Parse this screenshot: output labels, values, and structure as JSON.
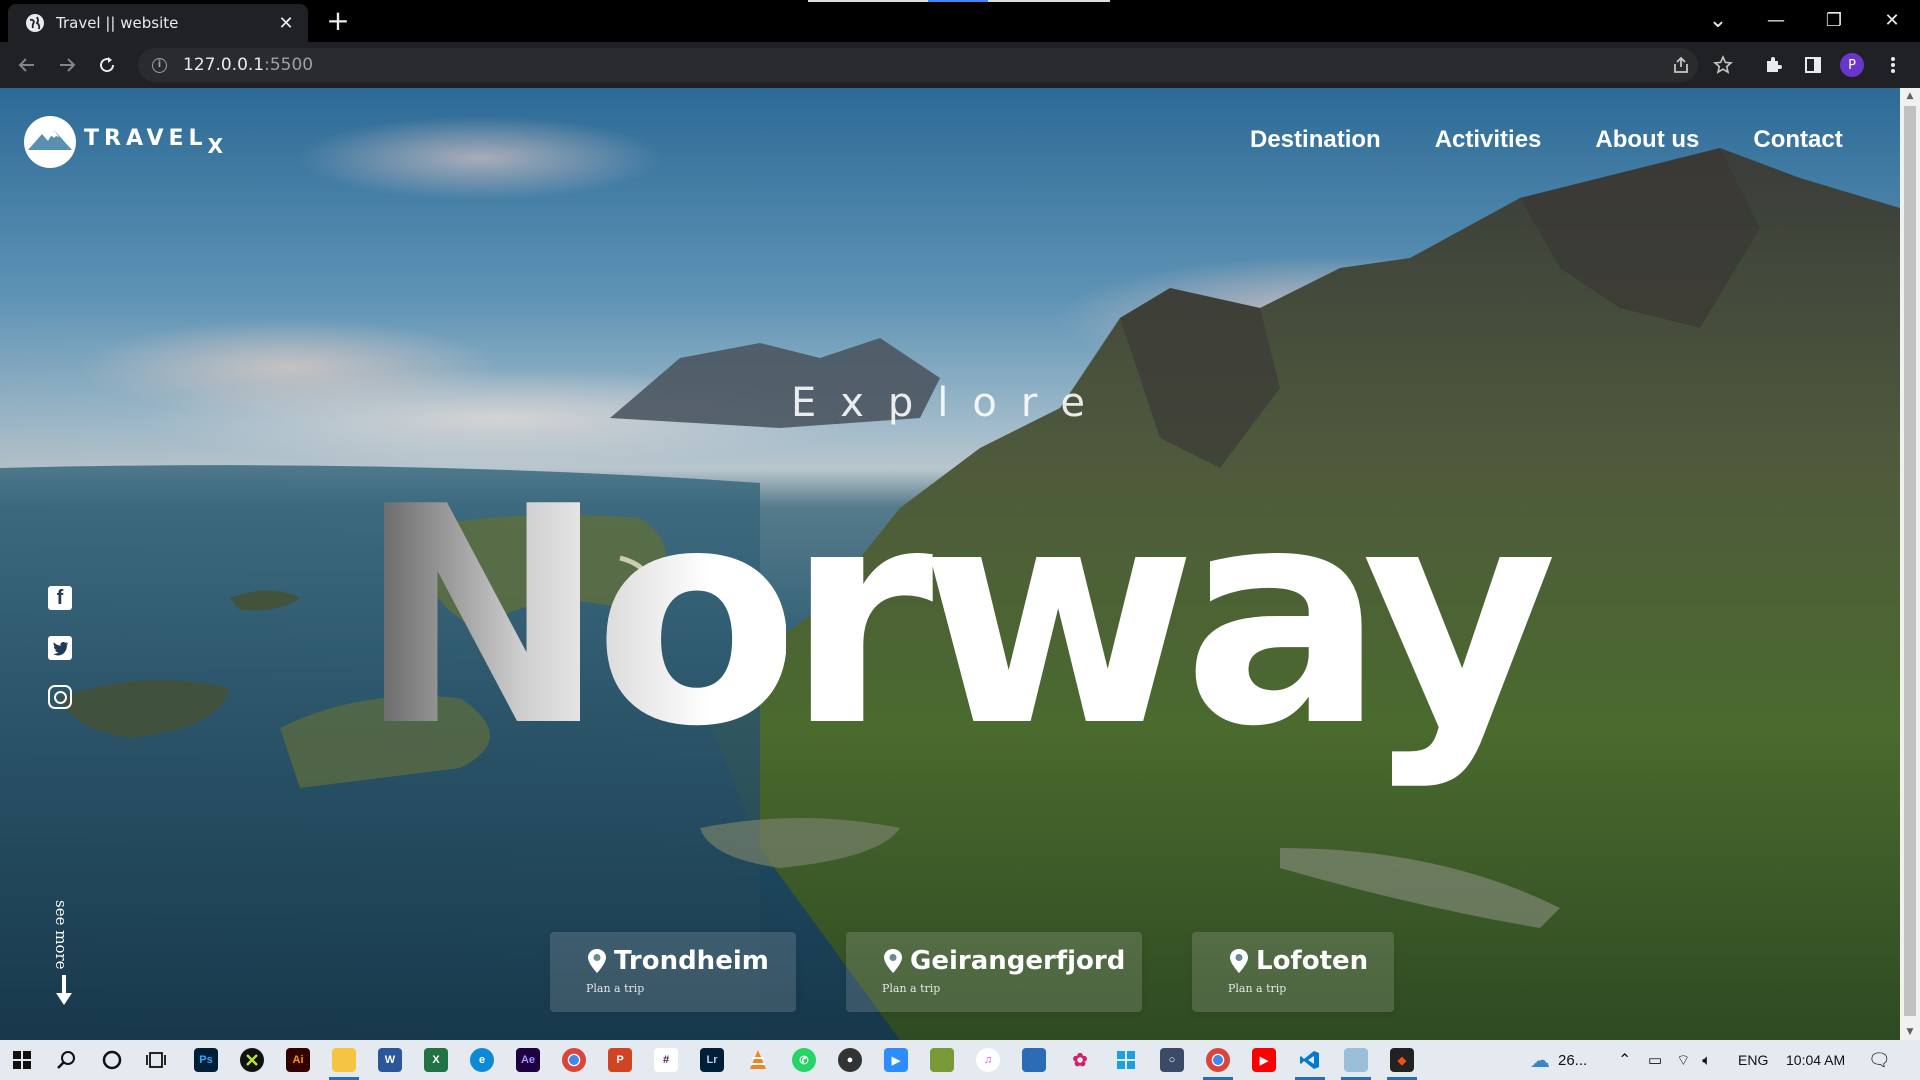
{
  "browser": {
    "tab_title": "Travel || website",
    "new_tab": "+",
    "tab_close": "✕",
    "url_host": "127.0.0.1",
    "url_port": ":5500",
    "profile_initial": "P",
    "minimize": "—",
    "restore": "❐",
    "close": "✕",
    "tab_search": "⌄"
  },
  "site": {
    "logo_text": "TRAVEL",
    "logo_sub": "X",
    "nav": [
      "Destination",
      "Activities",
      "About us",
      "Contact"
    ],
    "explore": "Explore",
    "country_first": "N",
    "country_second": "o",
    "country_rest": "rway",
    "social": [
      "facebook-icon",
      "twitter-icon",
      "instagram-icon"
    ],
    "see_more": "see more",
    "cards": [
      {
        "name": "Trondheim",
        "sub": "Plan a trip"
      },
      {
        "name": "Geirangerfjord",
        "sub": "Plan a trip"
      },
      {
        "name": "Lofoten",
        "sub": "Plan a trip"
      }
    ]
  },
  "taskbar": {
    "weather": "26...",
    "language": "ENG",
    "time": "10:04 AM"
  },
  "colors": {
    "chrome_bg": "#202124",
    "tab_bar": "#000000",
    "taskbar": "#e4eaf0",
    "profile": "#6a35c9"
  }
}
